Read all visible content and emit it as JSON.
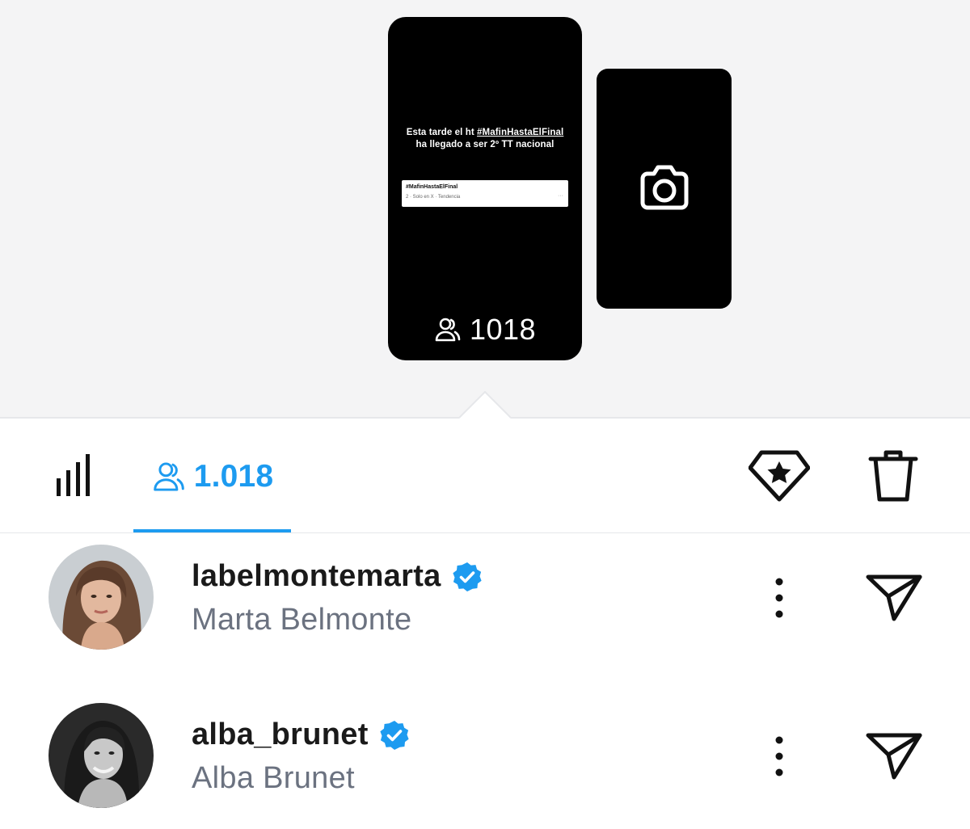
{
  "story": {
    "text_line1": "Esta tarde el ht ",
    "hashtag": "#MafinHastaElFinal",
    "text_line2": "ha llegado a ser 2º TT nacional",
    "trend_card": {
      "title": "#MafinHastaElFinal",
      "subtitle": "2 · Solo en X · Tendencia",
      "more": "···"
    },
    "viewer_count": "1018",
    "viewer_icon": "viewers-icon"
  },
  "second_story": {
    "icon": "camera-icon"
  },
  "toolbar": {
    "stats_icon": "bar-chart-icon",
    "viewers_label": "1.018",
    "highlight_icon": "diamond-star-icon",
    "delete_icon": "trash-icon",
    "accent_color": "#1d9bf0"
  },
  "viewers": [
    {
      "username": "labelmontemarta",
      "display_name": "Marta Belmonte",
      "verified": true,
      "more_icon": "more-vertical-icon",
      "send_icon": "send-icon"
    },
    {
      "username": "alba_brunet",
      "display_name": "Alba Brunet",
      "verified": true,
      "more_icon": "more-vertical-icon",
      "send_icon": "send-icon"
    }
  ],
  "colors": {
    "verified_badge": "#1d9bf0",
    "secondary_text": "#6b7280",
    "top_background": "#f4f4f5"
  }
}
